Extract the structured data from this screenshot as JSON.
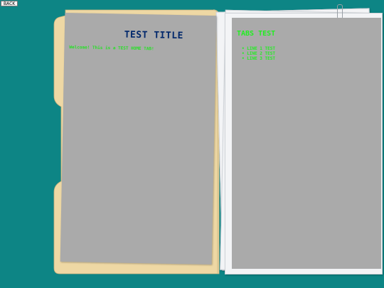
{
  "nav": {
    "back_label": "BACK"
  },
  "left_page": {
    "title": "TEST TITLE",
    "welcome": "Welcome! This is a TEST HOME TAB!"
  },
  "right_page": {
    "title": "TABS TEST",
    "lines": [
      "LINE 1 TEST",
      "LINE 2 TEST",
      "LINE 3 TEST"
    ]
  },
  "colors": {
    "background": "#0d8585",
    "folder": "#eed8a4",
    "page": "#aaaaaa",
    "title_blue": "#00276b",
    "text_green": "#22ee22"
  }
}
